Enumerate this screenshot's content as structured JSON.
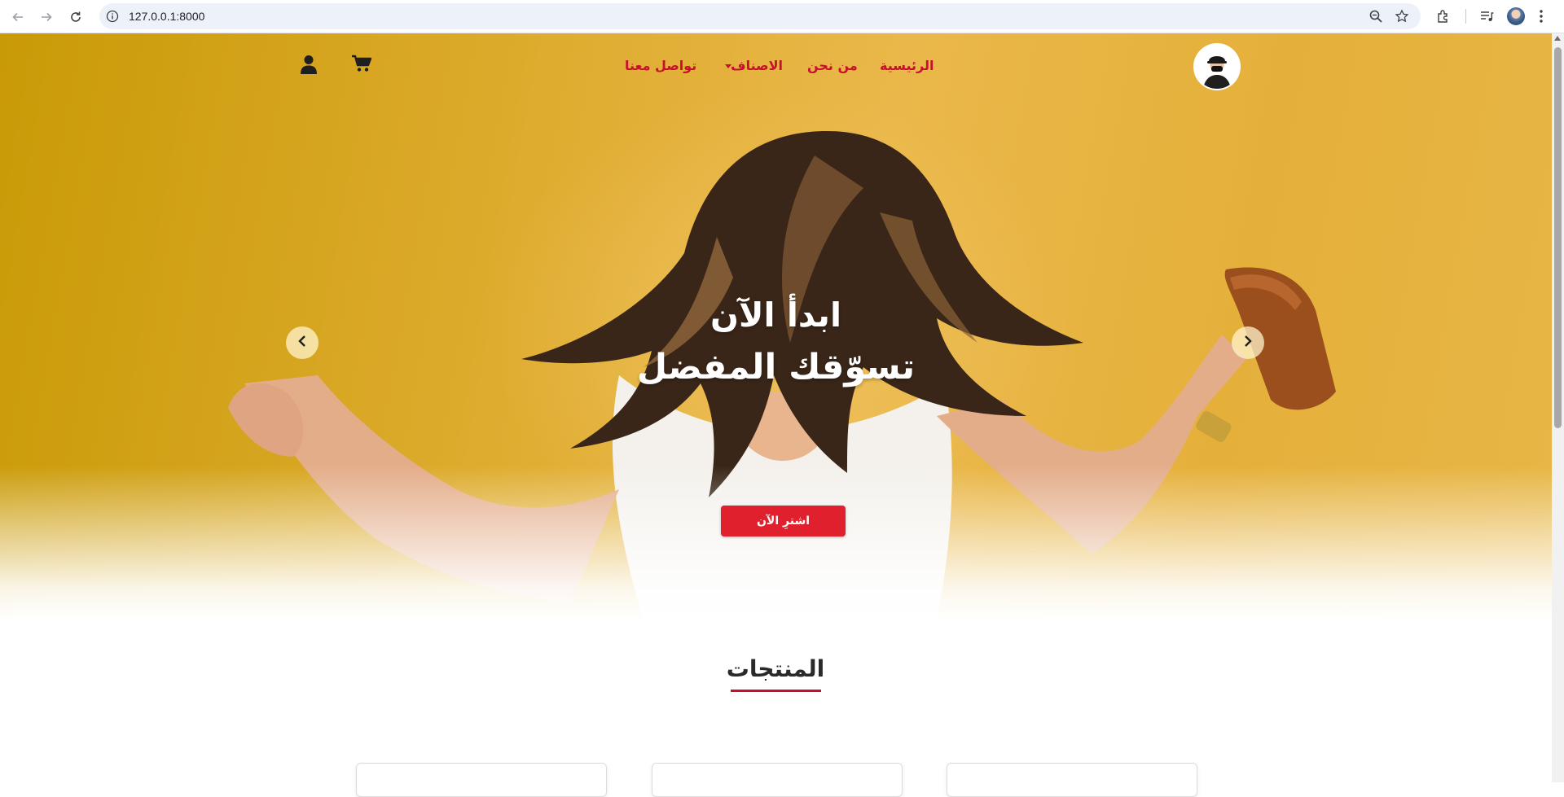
{
  "browser": {
    "url": "127.0.0.1:8000",
    "icons": [
      "back-icon",
      "forward-icon",
      "reload-icon",
      "info-icon",
      "zoom-icon",
      "star-icon",
      "extensions-icon",
      "media-icon",
      "profile-icon",
      "menu-icon"
    ]
  },
  "nav": {
    "links": [
      {
        "label": "الرئيسية"
      },
      {
        "label": "من نحن"
      },
      {
        "label": "الاصناف",
        "dropdown": true
      },
      {
        "label": "تواصل معنا"
      }
    ],
    "icons": [
      "cart-icon",
      "user-icon"
    ]
  },
  "hero": {
    "line1": "ابدأ الآن",
    "line2": "تسوّقك المفضل",
    "button": "اشترِ الآن"
  },
  "products": {
    "title": "المنتجات",
    "cards_visible": 3
  },
  "colors": {
    "accent": "#c8102e",
    "button": "#e0202d",
    "hero_background": "#e2b03c"
  }
}
